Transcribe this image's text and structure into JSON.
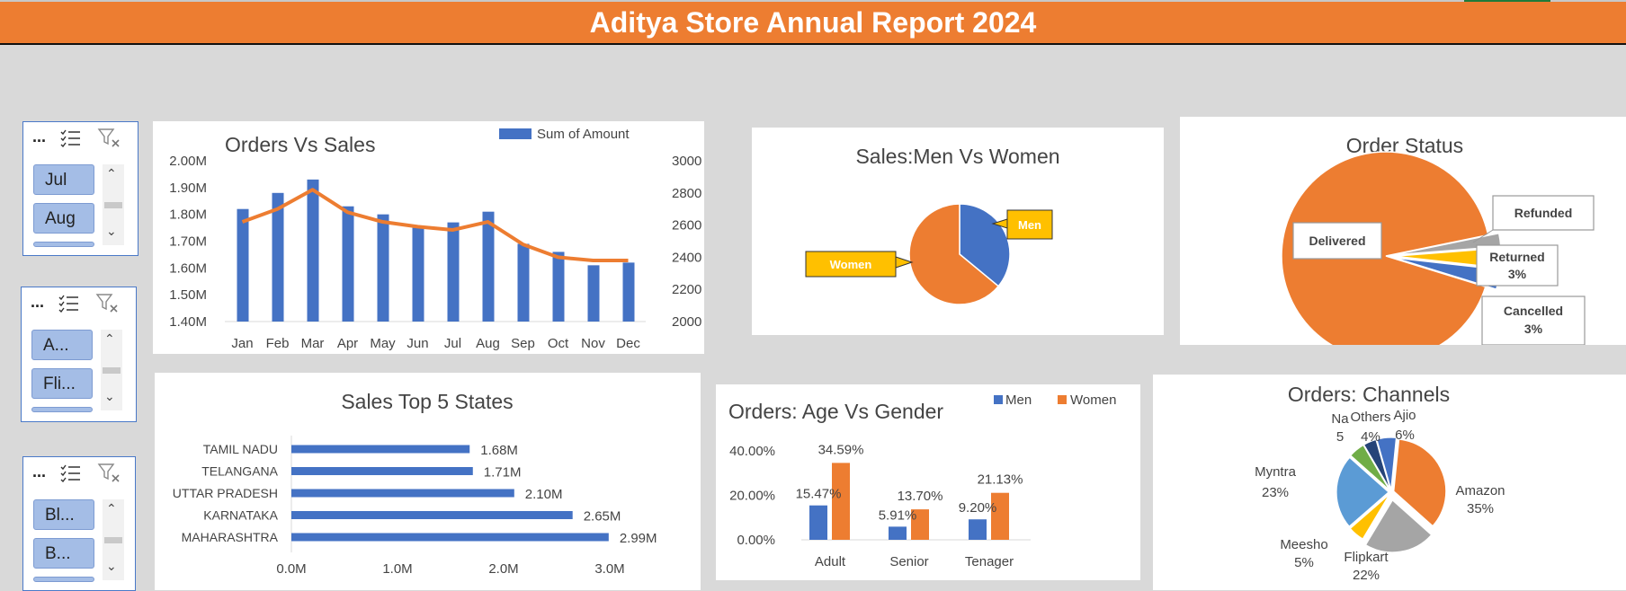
{
  "report_title": "Aditya Store Annual Report 2024",
  "slicers": [
    {
      "header": "...",
      "items": [
        "Jul",
        "Aug"
      ]
    },
    {
      "header": "...",
      "items": [
        "A...",
        "Fli..."
      ]
    },
    {
      "header": "...",
      "items": [
        "Bl...",
        "B..."
      ]
    }
  ],
  "icons": {
    "multiselect": "multiselect-icon",
    "clear_filter": "clear-filter-icon",
    "scroll_up": "chevron-up-icon",
    "scroll_down": "chevron-down-icon"
  },
  "colors": {
    "blue": "#4472c4",
    "orange": "#ed7d31",
    "gray": "#a5a5a5",
    "yellow": "#ffc000",
    "green": "#70ad47",
    "navy": "#264478",
    "lightblue": "#5b9bd5"
  },
  "chart_data": [
    {
      "id": "orders_vs_sales",
      "type": "bar",
      "title": "Orders Vs Sales",
      "legend": "Sum of Amount",
      "categories": [
        "Jan",
        "Feb",
        "Mar",
        "Apr",
        "May",
        "Jun",
        "Jul",
        "Aug",
        "Sep",
        "Oct",
        "Nov",
        "Dec"
      ],
      "series": [
        {
          "name": "Sum of Amount",
          "type": "bar",
          "values": [
            1.82,
            1.88,
            1.93,
            1.83,
            1.8,
            1.75,
            1.77,
            1.81,
            1.69,
            1.66,
            1.61,
            1.62
          ]
        },
        {
          "type": "line",
          "values": [
            2620,
            2700,
            2820,
            2680,
            2620,
            2590,
            2570,
            2620,
            2480,
            2400,
            2380,
            2380
          ]
        }
      ],
      "ylim": [
        1.4,
        2.0
      ],
      "y_ticks": [
        "1.40M",
        "1.50M",
        "1.60M",
        "1.70M",
        "1.80M",
        "1.90M",
        "2.00M"
      ],
      "y2lim": [
        2000,
        3000
      ],
      "y2_ticks": [
        "2000",
        "2200",
        "2400",
        "2600",
        "2800",
        "3000"
      ],
      "legend_position": "top-right"
    },
    {
      "id": "sales_men_women",
      "type": "pie",
      "title": "Sales:Men Vs Women",
      "labels": [
        "Men",
        "Women"
      ],
      "values": [
        36,
        64
      ]
    },
    {
      "id": "order_status",
      "type": "pie",
      "title": "Order Status",
      "labels": [
        "Delivered",
        "Refunded",
        "Returned",
        "Cancelled"
      ],
      "values": [
        92,
        2,
        3,
        3
      ],
      "data_labels": [
        "",
        "",
        "3%",
        "3%"
      ]
    },
    {
      "id": "top5_states",
      "type": "bar",
      "orientation": "horizontal",
      "title": "Sales Top 5 States",
      "categories": [
        "TAMIL NADU",
        "TELANGANA",
        "UTTAR PRADESH",
        "KARNATAKA",
        "MAHARASHTRA"
      ],
      "values": [
        1.68,
        1.71,
        2.1,
        2.65,
        2.99
      ],
      "data_labels": [
        "1.68M",
        "1.71M",
        "2.10M",
        "2.65M",
        "2.99M"
      ],
      "xlim": [
        0,
        3.0
      ],
      "x_ticks": [
        "0.0M",
        "1.0M",
        "2.0M",
        "3.0M"
      ]
    },
    {
      "id": "age_vs_gender",
      "type": "bar",
      "title": "Orders: Age Vs Gender",
      "categories": [
        "Adult",
        "Senior",
        "Tenager"
      ],
      "series": [
        {
          "name": "Men",
          "values": [
            15.47,
            5.91,
            9.2
          ],
          "labels": [
            "15.47%",
            "5.91%",
            "9.20%"
          ]
        },
        {
          "name": "Women",
          "values": [
            34.59,
            13.7,
            21.13
          ],
          "labels": [
            "34.59%",
            "13.70%",
            "21.13%"
          ]
        }
      ],
      "ylim": [
        0,
        40
      ],
      "y_ticks": [
        "0.00%",
        "20.00%",
        "40.00%"
      ],
      "legend_position": "top-right"
    },
    {
      "id": "channels",
      "type": "pie",
      "title": "Orders: Channels",
      "slices": [
        {
          "label": "Amazon",
          "pct": "35%",
          "value": 35
        },
        {
          "label": "Flipkart",
          "pct": "22%",
          "value": 22
        },
        {
          "label": "Meesho",
          "pct": "5%",
          "value": 5
        },
        {
          "label": "Myntra",
          "pct": "23%",
          "value": 23
        },
        {
          "label": "Na",
          "pct": "5",
          "value": 5
        },
        {
          "label": "Others",
          "pct": "4%",
          "value": 4
        },
        {
          "label": "Ajio",
          "pct": "6%",
          "value": 6
        }
      ]
    }
  ]
}
